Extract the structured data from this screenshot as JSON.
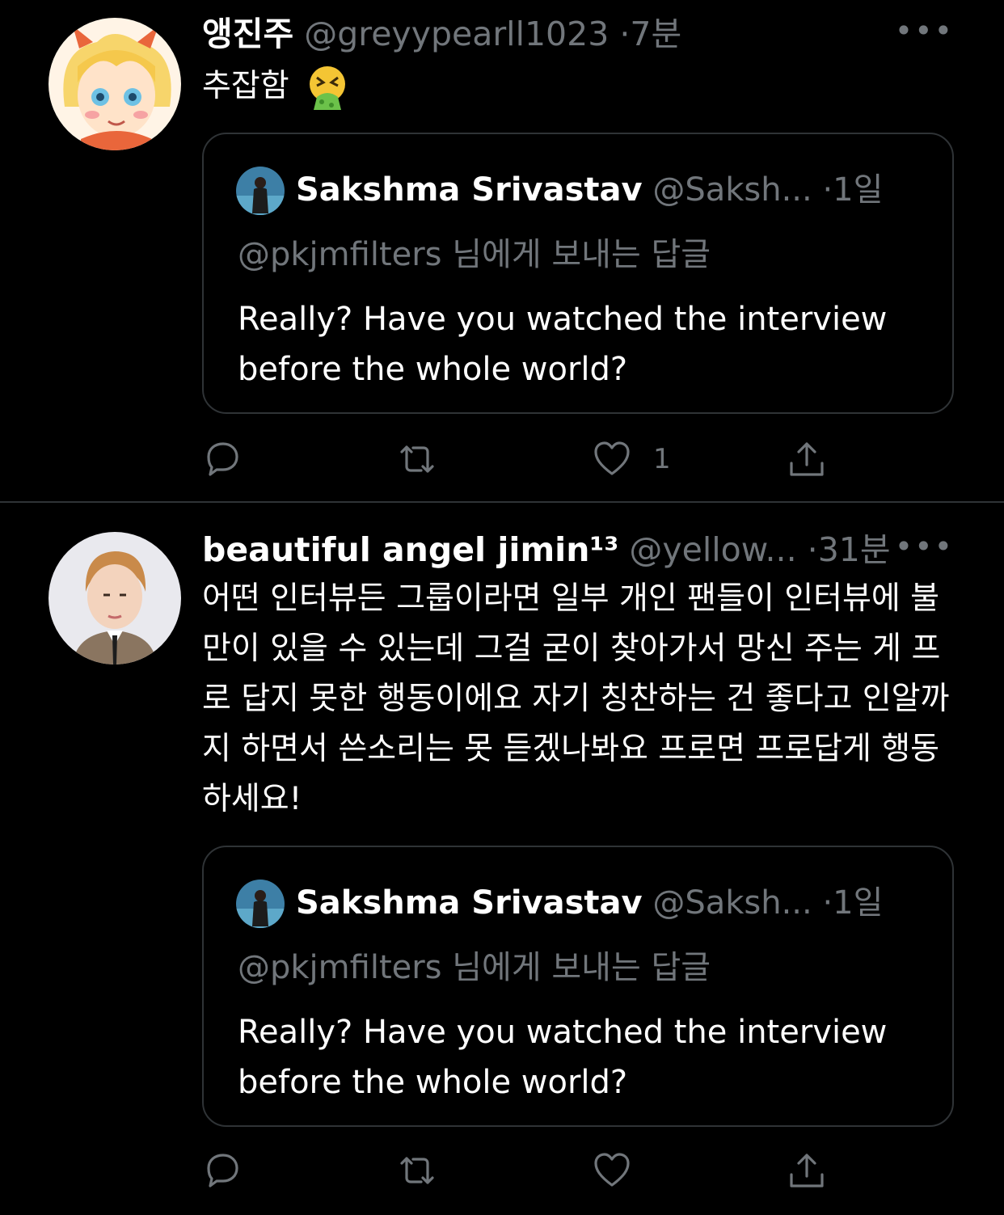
{
  "tweets": [
    {
      "display_name": "앵진주",
      "handle": "@greyypearll1023",
      "time": "·7분",
      "text": "추잡함",
      "emoji_icon": "vomiting-face-icon",
      "quoted": {
        "display_name": "Sakshma Srivastav",
        "handle": "@Saksh...",
        "time": "·1일",
        "reply_to": "@pkjmfilters 님에게 보내는 답글",
        "text": "Really? Have you watched the interview before the whole world?"
      },
      "actions": {
        "reply_count": "",
        "retweet_count": "",
        "like_count": "1"
      }
    },
    {
      "display_name": "beautiful angel jimin¹³",
      "handle": "@yellow...",
      "time": "·31분",
      "text": "어떤 인터뷰든 그룹이라면 일부 개인 팬들이 인터뷰에 불만이 있을 수 있는데 그걸 굳이 찾아가서 망신 주는 게 프로 답지 못한 행동이에요 자기 칭찬하는 건 좋다고 인알까지 하면서 쓴소리는 못 듣겠나봐요 프로면 프로답게 행동하세요!",
      "quoted": {
        "display_name": "Sakshma Srivastav",
        "handle": "@Saksh...",
        "time": "·1일",
        "reply_to": "@pkjmfilters 님에게 보내는 답글",
        "text": "Really? Have you watched the interview before the whole world?"
      },
      "actions": {
        "reply_count": "",
        "retweet_count": "",
        "like_count": ""
      }
    }
  ],
  "more_symbol": "•••",
  "colors": {
    "background": "#000000",
    "muted": "#71767b",
    "border": "#2f3336",
    "text": "#ffffff"
  }
}
